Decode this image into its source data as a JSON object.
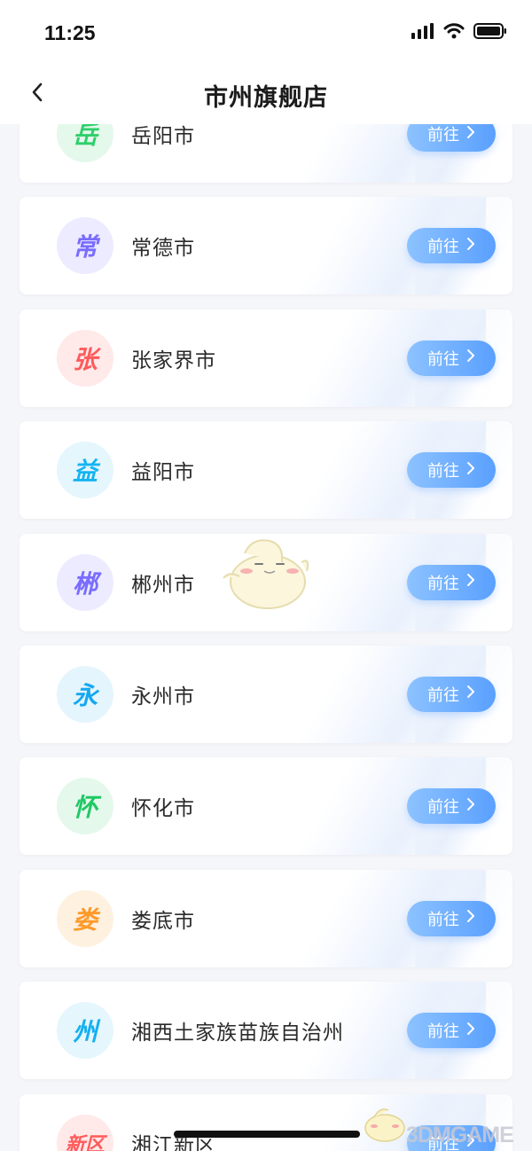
{
  "status_bar": {
    "time": "11:25"
  },
  "header": {
    "title": "市州旗舰店"
  },
  "go_label": "前往",
  "cities": [
    {
      "badge": "岳",
      "name": "岳阳市",
      "badge_color": "#2fcf6b",
      "badge_bg": "#e5f8ec"
    },
    {
      "badge": "常",
      "name": "常德市",
      "badge_color": "#7a6cff",
      "badge_bg": "#ecebff"
    },
    {
      "badge": "张",
      "name": "张家界市",
      "badge_color": "#ff5a5a",
      "badge_bg": "#ffe9e9"
    },
    {
      "badge": "益",
      "name": "益阳市",
      "badge_color": "#14b4f0",
      "badge_bg": "#e5f6fd"
    },
    {
      "badge": "郴",
      "name": "郴州市",
      "badge_color": "#7a6cff",
      "badge_bg": "#ecebff"
    },
    {
      "badge": "永",
      "name": "永州市",
      "badge_color": "#14a8f0",
      "badge_bg": "#e5f5fd"
    },
    {
      "badge": "怀",
      "name": "怀化市",
      "badge_color": "#20c865",
      "badge_bg": "#e5f8ec"
    },
    {
      "badge": "娄",
      "name": "娄底市",
      "badge_color": "#ff9a2a",
      "badge_bg": "#fff1e0"
    },
    {
      "badge": "州",
      "name": "湘西土家族苗族自治州",
      "badge_color": "#14b0f0",
      "badge_bg": "#e5f6fd"
    },
    {
      "badge": "新区",
      "name": "湘江新区",
      "badge_color": "#ff5a5a",
      "badge_bg": "#ffe9e9"
    }
  ],
  "watermark": "3DMGAME",
  "icons": {
    "back": "chevron-left-icon",
    "go": "chevron-right-icon"
  }
}
